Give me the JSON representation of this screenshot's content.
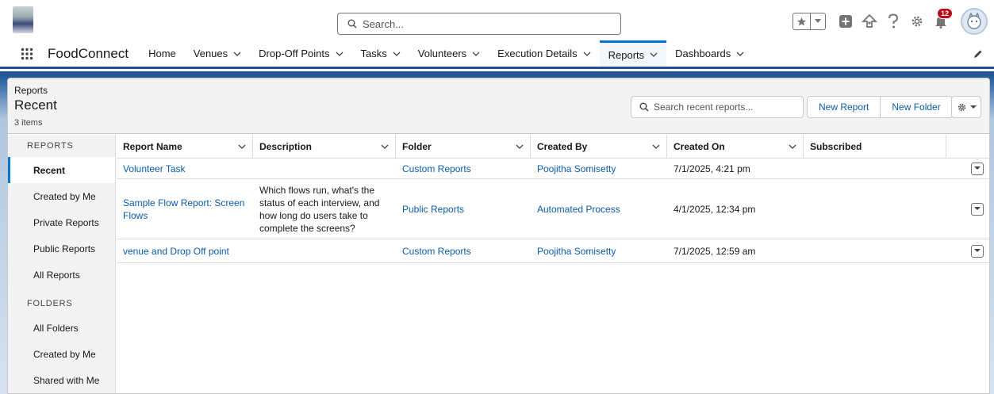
{
  "header": {
    "search_placeholder": "Search...",
    "notification_count": "12"
  },
  "nav": {
    "app_name": "FoodConnect",
    "items": [
      {
        "label": "Home",
        "dropdown": false
      },
      {
        "label": "Venues",
        "dropdown": true
      },
      {
        "label": "Drop-Off Points",
        "dropdown": true
      },
      {
        "label": "Tasks",
        "dropdown": true
      },
      {
        "label": "Volunteers",
        "dropdown": true
      },
      {
        "label": "Execution Details",
        "dropdown": true
      },
      {
        "label": "Reports",
        "dropdown": true,
        "active": true
      },
      {
        "label": "Dashboards",
        "dropdown": true
      }
    ]
  },
  "page": {
    "eyebrow": "Reports",
    "title": "Recent",
    "count": "3 items",
    "search_placeholder": "Search recent reports...",
    "new_report_label": "New Report",
    "new_folder_label": "New Folder"
  },
  "sidebar": {
    "reports_heading": "REPORTS",
    "report_items": [
      "Recent",
      "Created by Me",
      "Private Reports",
      "Public Reports",
      "All Reports"
    ],
    "folders_heading": "FOLDERS",
    "folder_items": [
      "All Folders",
      "Created by Me",
      "Shared with Me"
    ]
  },
  "table": {
    "columns": [
      "Report Name",
      "Description",
      "Folder",
      "Created By",
      "Created On",
      "Subscribed"
    ],
    "rows": [
      {
        "name": "Volunteer Task",
        "description": "",
        "folder": "Custom Reports",
        "created_by": "Poojitha Somisetty",
        "created_on": "7/1/2025, 4:21 pm"
      },
      {
        "name": "Sample Flow Report: Screen Flows",
        "description": "Which flows run, what's the status of each interview, and how long do users take to complete the screens?",
        "folder": "Public Reports",
        "created_by": "Automated Process",
        "created_on": "4/1/2025, 12:34 pm"
      },
      {
        "name": "venue and Drop Off point",
        "description": "",
        "folder": "Custom Reports",
        "created_by": "Poojitha Somisetty",
        "created_on": "7/1/2025, 12:59 am"
      }
    ]
  },
  "colors": {
    "brand_blue": "#0176d3",
    "link_blue": "#0b5cab",
    "nav_border": "#1b5297"
  }
}
